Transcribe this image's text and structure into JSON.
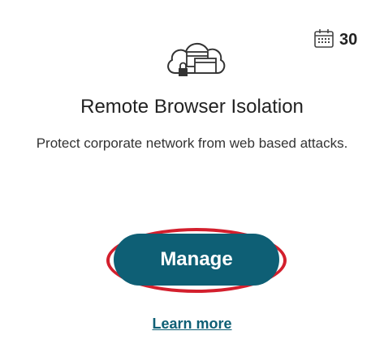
{
  "card": {
    "title": "Remote Browser Isolation",
    "description": "Protect corporate network from web based attacks.",
    "badge": {
      "icon": "calendar-icon",
      "count": "30"
    },
    "hero_icon": "cloud-browser-lock-icon",
    "manage_label": "Manage",
    "learn_more_label": "Learn more",
    "accent_color": "#0e5f75",
    "highlight_color": "#d31f2d"
  }
}
